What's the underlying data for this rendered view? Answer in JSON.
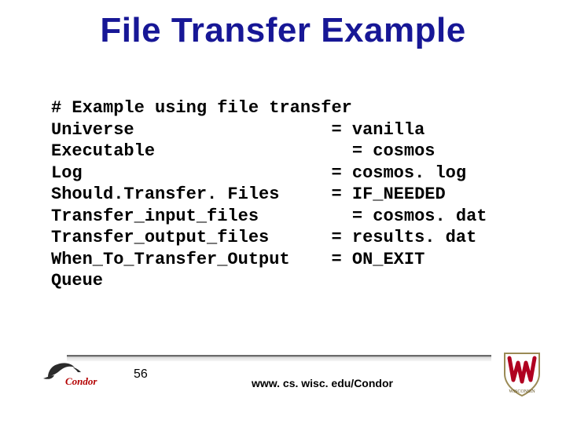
{
  "title": "File Transfer Example",
  "code": {
    "comment": "# Example using file transfer",
    "lines": [
      {
        "key": "Universe",
        "eq": "= vanilla",
        "indent": 0,
        "eqcol": 27
      },
      {
        "key": "Executable",
        "eq": "= cosmos",
        "indent": 0,
        "eqcol": 29
      },
      {
        "key": "Log",
        "eq": "= cosmos. log",
        "indent": 0,
        "eqcol": 27
      },
      {
        "key": "Should.Transfer. Files",
        "eq": "= IF_NEEDED",
        "indent": 0,
        "eqcol": 27
      },
      {
        "key": "Transfer_input_files",
        "eq": "= cosmos. dat",
        "indent": 0,
        "eqcol": 29
      },
      {
        "key": "Transfer_output_files",
        "eq": "= results. dat",
        "indent": 0,
        "eqcol": 27
      },
      {
        "key": "When_To_Transfer_Output",
        "eq": "= ON_EXIT",
        "indent": 0,
        "eqcol": 27
      },
      {
        "key": "Queue",
        "eq": "",
        "indent": 0,
        "eqcol": 0
      }
    ]
  },
  "footer": {
    "page": "56",
    "url": "www. cs. wisc. edu/Condor",
    "left_logo": "Condor",
    "right_logo": "Wisconsin"
  },
  "chart_data": {
    "type": "table",
    "title": "Condor submit description (file transfer example)",
    "rows": [
      {
        "key": "Universe",
        "value": "vanilla"
      },
      {
        "key": "Executable",
        "value": "cosmos"
      },
      {
        "key": "Log",
        "value": "cosmos.log"
      },
      {
        "key": "ShouldTransferFiles",
        "value": "IF_NEEDED"
      },
      {
        "key": "Transfer_input_files",
        "value": "cosmos.dat"
      },
      {
        "key": "Transfer_output_files",
        "value": "results.dat"
      },
      {
        "key": "When_To_Transfer_Output",
        "value": "ON_EXIT"
      },
      {
        "key": "Queue",
        "value": ""
      }
    ]
  }
}
